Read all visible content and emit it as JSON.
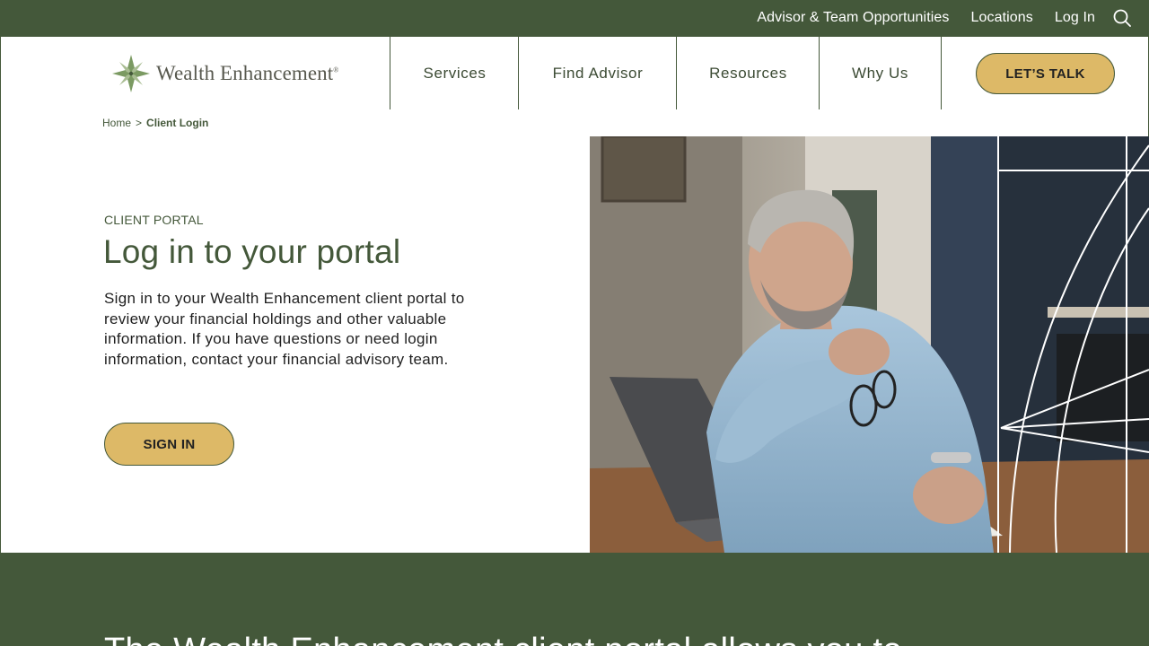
{
  "topbar": {
    "links": [
      "Advisor & Team Opportunities",
      "Locations",
      "Log In"
    ],
    "search_icon": "search-icon"
  },
  "brand": {
    "name": "Wealth Enhancement",
    "mark": "®",
    "logo_icon": "leaf-star-logo-icon"
  },
  "nav": {
    "items": [
      "Services",
      "Find Advisor",
      "Resources",
      "Why Us"
    ],
    "cta": "LET’S TALK"
  },
  "breadcrumb": {
    "home": "Home",
    "separator": ">",
    "current": "Client Login"
  },
  "hero": {
    "eyebrow": "CLIENT PORTAL",
    "title": "Log in to your portal",
    "body": "Sign in to your Wealth Enhancement client portal to review your financial holdings and other valuable information. If you have questions or need login information, contact your financial advisory team.",
    "button": "SIGN IN"
  },
  "footer": {
    "teaser": "The Wealth Enhancement client portal allows you to"
  },
  "colors": {
    "brand_green": "#44583a",
    "accent_gold": "#ddb967"
  }
}
